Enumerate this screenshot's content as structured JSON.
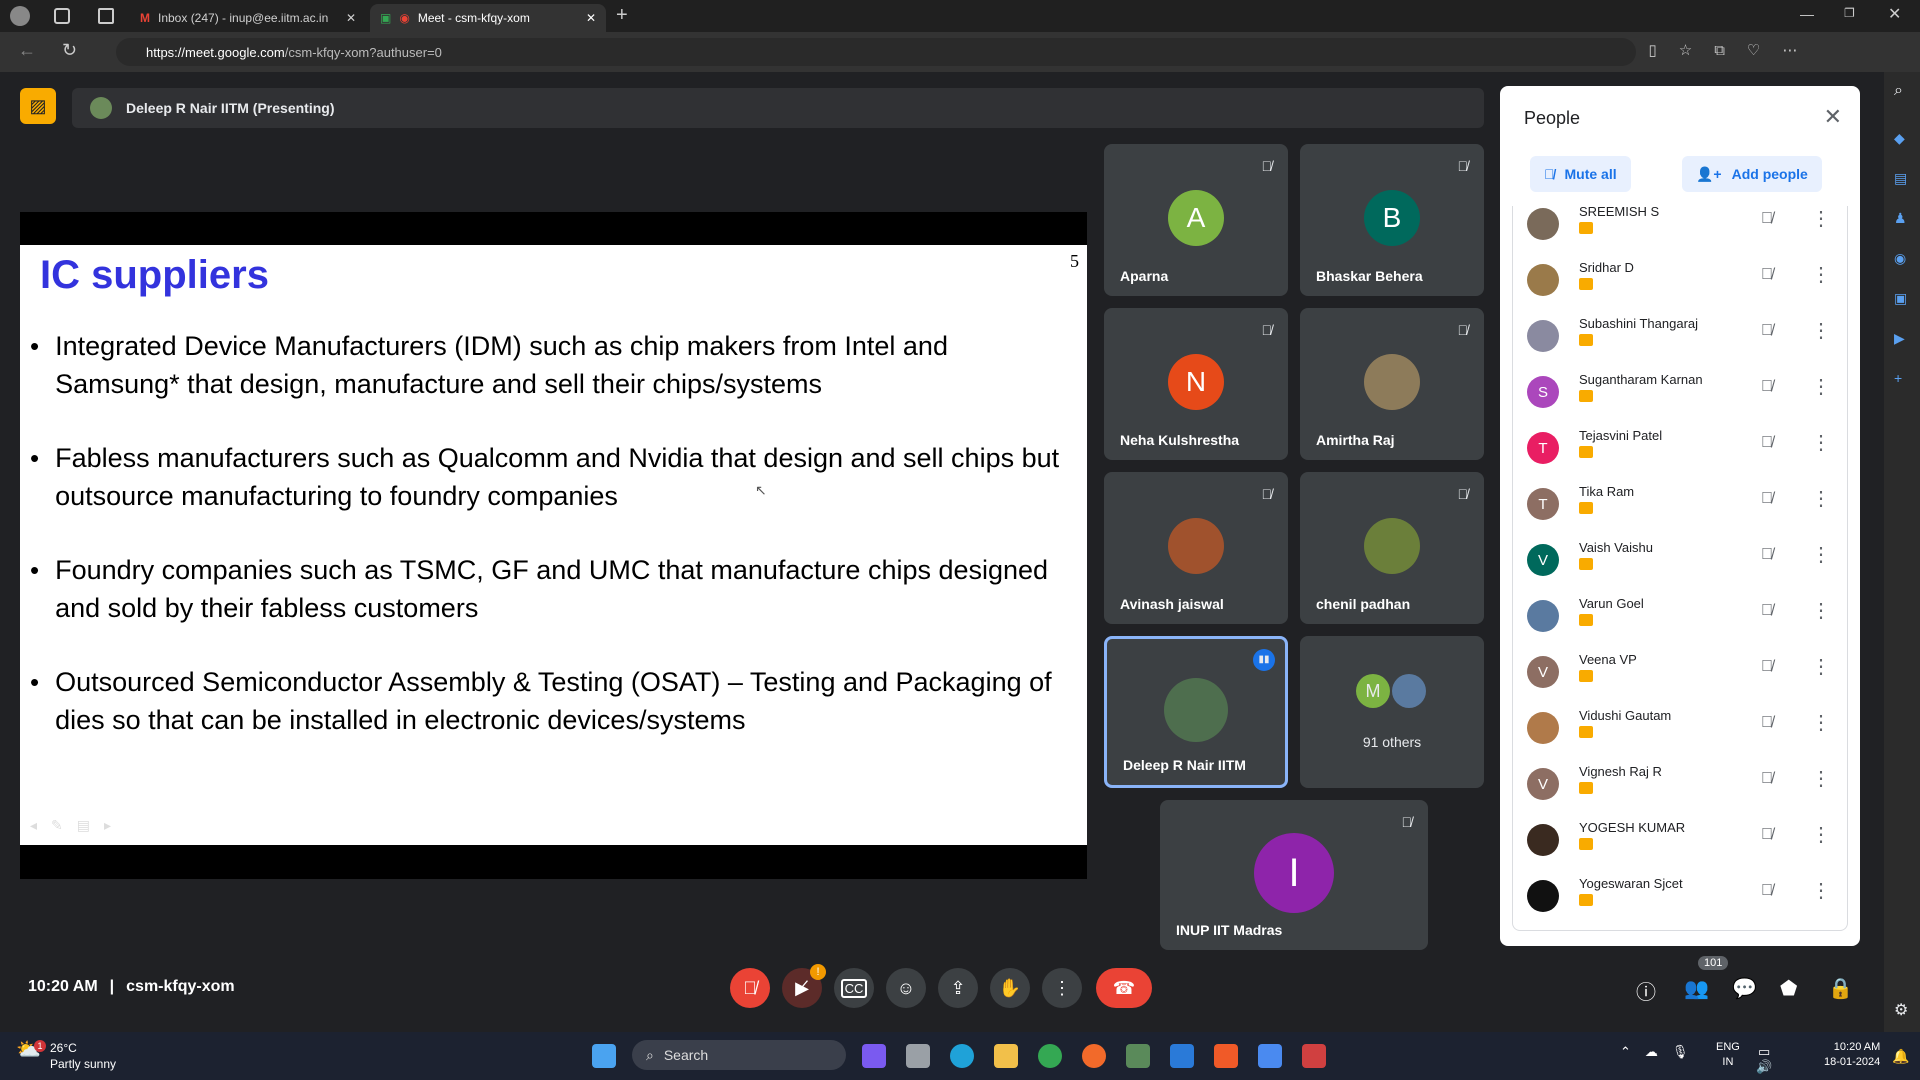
{
  "browser": {
    "tabs": [
      {
        "label": "Inbox (247) - inup@ee.iitm.ac.in",
        "icon": "gmail-icon"
      },
      {
        "label": "Meet - csm-kfqy-xom",
        "icon": "meet-icon"
      }
    ],
    "url_host": "https://meet.google.com",
    "url_path": "/csm-kfqy-xom?authuser=0"
  },
  "presenter_bar": {
    "label": "Deleep R Nair IITM (Presenting)"
  },
  "slide": {
    "title": "IC suppliers",
    "page_number": "5",
    "bullets": [
      "Integrated Device Manufacturers (IDM) such as chip makers from Intel and Samsung* that design, manufacture and sell their chips/systems",
      "Fabless manufacturers such as Qualcomm and Nvidia that design and sell chips but outsource manufacturing to foundry companies",
      "Foundry companies such as TSMC, GF and UMC that manufacture chips designed and sold by their fabless customers",
      "Outsourced Semiconductor Assembly & Testing (OSAT) – Testing and Packaging of dies so that can be installed in electronic devices/systems"
    ]
  },
  "tiles": [
    {
      "name": "Aparna",
      "initial": "A",
      "color": "#7cb342"
    },
    {
      "name": "Bhaskar Behera",
      "initial": "B",
      "color": "#00695c"
    },
    {
      "name": "Neha Kulshrestha",
      "initial": "N",
      "color": "#e64a19"
    },
    {
      "name": "Amirtha Raj",
      "initial": "",
      "color": "#8d7b5a"
    },
    {
      "name": "Avinash jaiswal",
      "initial": "",
      "color": "#a0522d"
    },
    {
      "name": "chenil padhan",
      "initial": "",
      "color": "#6b7f3a"
    },
    {
      "name": "Deleep R Nair IITM",
      "initial": "",
      "color": "#4e6e4e"
    },
    {
      "name": "91 others",
      "initial": "M",
      "color": "#7cb342"
    },
    {
      "name": "INUP IIT Madras",
      "initial": "I",
      "color": "#8e24aa"
    }
  ],
  "people_panel": {
    "title": "People",
    "mute_all": "Mute all",
    "add_people": "Add people",
    "participants": [
      {
        "name": "SREEMISH S",
        "initial": "",
        "color": "#7a6a5a"
      },
      {
        "name": "Sridhar D",
        "initial": "",
        "color": "#9a7a4a"
      },
      {
        "name": "Subashini Thangaraj",
        "initial": "",
        "color": "#8a8aa0"
      },
      {
        "name": "Sugantharam Karnan",
        "initial": "S",
        "color": "#ab47bc"
      },
      {
        "name": "Tejasvini Patel",
        "initial": "T",
        "color": "#e91e63"
      },
      {
        "name": "Tika Ram",
        "initial": "T",
        "color": "#8d6e63"
      },
      {
        "name": "Vaish Vaishu",
        "initial": "V",
        "color": "#00695c"
      },
      {
        "name": "Varun Goel",
        "initial": "",
        "color": "#5a7aa0"
      },
      {
        "name": "Veena VP",
        "initial": "V",
        "color": "#8d6e63"
      },
      {
        "name": "Vidushi Gautam",
        "initial": "",
        "color": "#b07a4a"
      },
      {
        "name": "Vignesh Raj R",
        "initial": "V",
        "color": "#8d6e63"
      },
      {
        "name": "YOGESH KUMAR",
        "initial": "",
        "color": "#3a2a20"
      },
      {
        "name": "Yogeswaran Sjcet",
        "initial": "",
        "color": "#111111"
      }
    ]
  },
  "bottom_bar": {
    "time": "10:20 AM",
    "meeting_code": "csm-kfqy-xom",
    "people_count": "101",
    "camera_alert": "!"
  },
  "taskbar": {
    "temp": "26°C",
    "weather": "Partly sunny",
    "weather_badge": "1",
    "search": "Search",
    "lang": "ENG",
    "region": "IN",
    "time": "10:20 AM",
    "date": "18-01-2024"
  }
}
